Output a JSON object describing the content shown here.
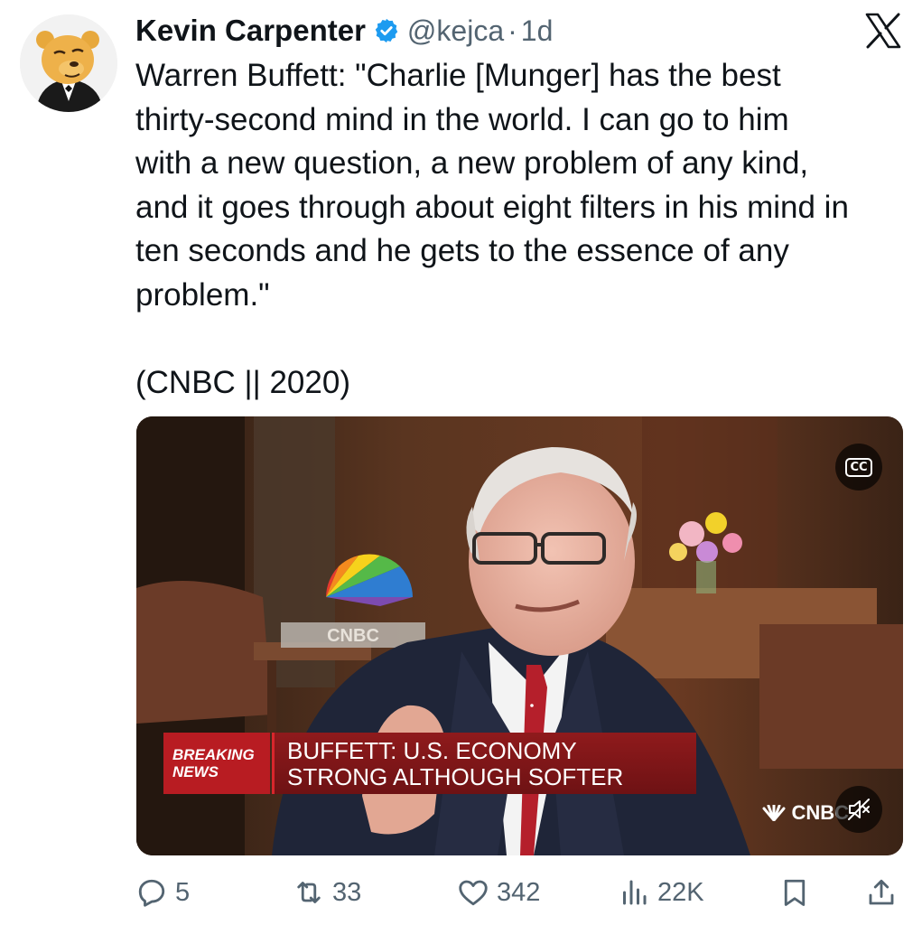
{
  "author": {
    "name": "Kevin Carpenter",
    "handle": "@kejca",
    "time": "1d",
    "separator": "·"
  },
  "tweet": {
    "text": "Warren Buffett: \"Charlie [Munger] has the best\nthirty-second mind in the world. I can go to him\nwith a new question, a new problem of any kind,\nand it goes through about eight filters in his mind in\nten seconds and he gets to the essence of any\nproblem.\"\n\n(CNBC || 2020)"
  },
  "media": {
    "cc_label": "CC",
    "breaking_label": "BREAKING\nNEWS",
    "headline": "BUFFETT: U.S. ECONOMY\nSTRONG ALTHOUGH SOFTER",
    "network_bug": "CNBC",
    "studio_logo_text": "CNBC"
  },
  "actions": {
    "replies": "5",
    "reposts": "33",
    "likes": "342",
    "views": "22K"
  },
  "colors": {
    "text": "#0f1419",
    "secondary": "#536471",
    "verified": "#1d9bf0",
    "breaking_red": "#b81c22"
  }
}
